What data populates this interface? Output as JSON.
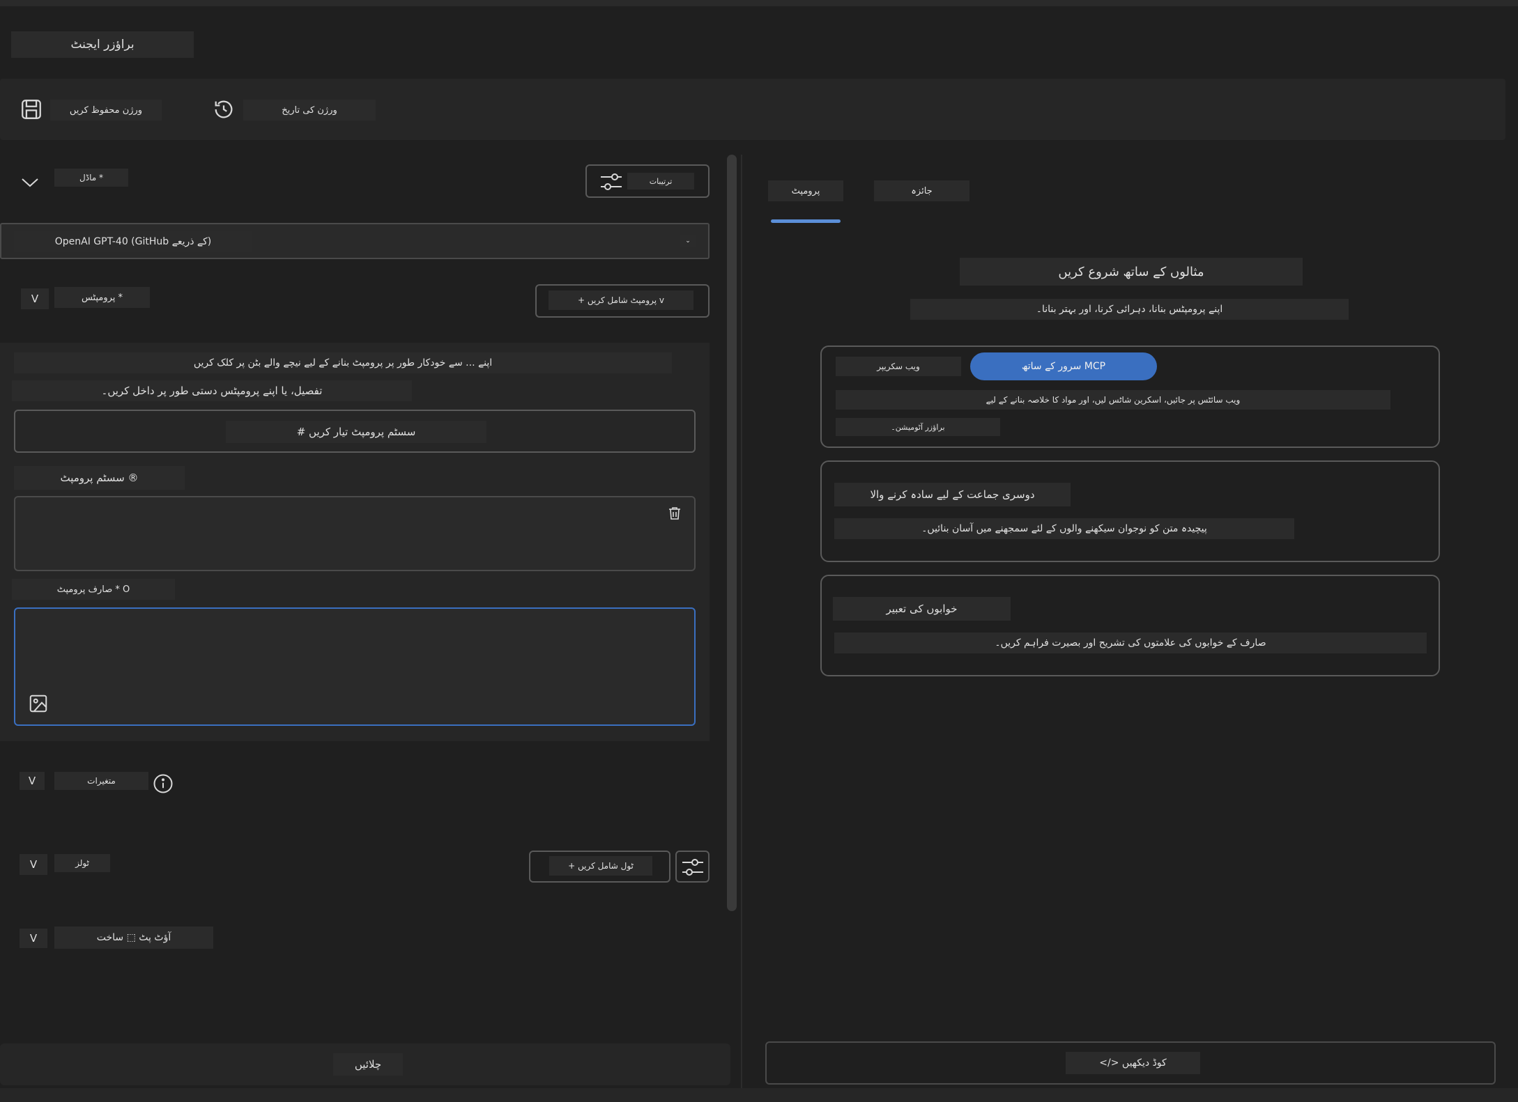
{
  "app": {
    "title": "براؤزر ایجنٹ"
  },
  "toolbar": {
    "save_label": "ورژن محفوظ کریں",
    "history_label": "ورژن کی تاریخ"
  },
  "model": {
    "section_label": "ماڈل *",
    "settings_label": "ترتیبات",
    "selected": "OpenAI GPT-40 (GitHub کے ذریعے)"
  },
  "prompts": {
    "section_label": "پرومپٹس *",
    "add_prompt_label": "+ پرومپٹ شامل کریں v",
    "hint_line1": "اپنے ... سے خودکار طور پر پرومپٹ بنانے کے لیے نیچے والے بٹن پر کلک کریں",
    "hint_line2": "تفصیل، یا اپنے پرومپٹس دستی طور پر داخل کریں۔",
    "generate_label": "# سسٹم پرومپٹ تیار کریں",
    "system_label": "سسٹم پرومپٹ ®",
    "user_label": "صارف پرومپٹ * O"
  },
  "variables": {
    "label": "متغیرات"
  },
  "tools": {
    "label": "ٹولز",
    "add_label": "+ ٹول شامل کریں"
  },
  "output": {
    "label": "آؤٹ پٹ ⬚ ساخت"
  },
  "run": {
    "label": "چلائیں"
  },
  "chevrons": {
    "v": "V"
  },
  "tabs": {
    "prompt": "پرومپٹ",
    "review": "جائزہ"
  },
  "examples": {
    "title": "مثالوں کے ساتھ شروع کریں",
    "subtitle": "اپنے پرومپٹس بنانا، دہرائی کرنا، اور بہتر بنانا۔",
    "cards": [
      {
        "tag": "ویب سکریپر",
        "chip": "سرور کے ساتھ MCP",
        "desc": "ویب سائٹس پر جائیں، اسکرین شاٹس لیں، اور مواد کا خلاصہ بنانے کے لیے",
        "desc2": "براؤزر آٹومیشن۔"
      },
      {
        "title": "دوسری جماعت کے لیے سادہ کرنے والا",
        "desc": "پیچیدہ متن کو نوجوان سیکھنے والوں کے لئے سمجھنے میں آسان بنائیں۔"
      },
      {
        "title": "خوابوں کی تعبیر",
        "desc": "صارف کے خوابوں کی علامتوں کی تشریح اور بصیرت فراہم کریں۔"
      }
    ]
  },
  "view_code": {
    "label": "</> کوڈ دیکھیں"
  },
  "colors": {
    "accent": "#3a6fc0",
    "tab_underline": "#5b8fd8"
  }
}
